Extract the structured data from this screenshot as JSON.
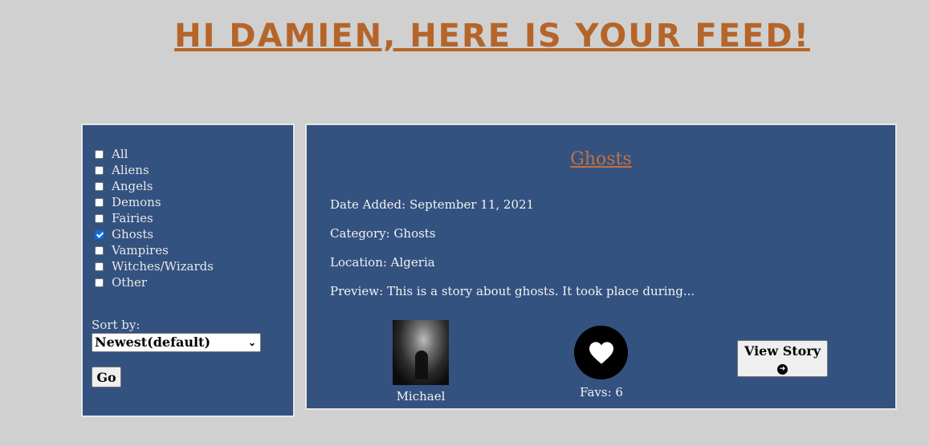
{
  "header": {
    "title": "Hi Damien, here is your feed!"
  },
  "filters": {
    "categories": [
      {
        "label": "All",
        "checked": false
      },
      {
        "label": "Aliens",
        "checked": false
      },
      {
        "label": "Angels",
        "checked": false
      },
      {
        "label": "Demons",
        "checked": false
      },
      {
        "label": "Fairies",
        "checked": false
      },
      {
        "label": "Ghosts",
        "checked": true
      },
      {
        "label": "Vampires",
        "checked": false
      },
      {
        "label": "Witches/Wizards",
        "checked": false
      },
      {
        "label": "Other",
        "checked": false
      }
    ],
    "sort_label": "Sort by:",
    "sort_value": "Newest(default)",
    "go_label": "Go"
  },
  "story": {
    "title": "Ghosts",
    "date_added": "Date Added: September 11, 2021",
    "category": "Category: Ghosts",
    "location": "Location: Algeria",
    "preview": "Preview: This is a story about ghosts. It took place during...",
    "author": "Michael",
    "favs": "Favs: 6",
    "view_label": "View Story"
  },
  "colors": {
    "background": "#d0d0d0",
    "panel": "#335280",
    "accent": "#b5652a"
  },
  "icons": {
    "fav": "heart-icon",
    "view": "arrow-right-circle-icon",
    "select": "chevron-down-icon"
  }
}
